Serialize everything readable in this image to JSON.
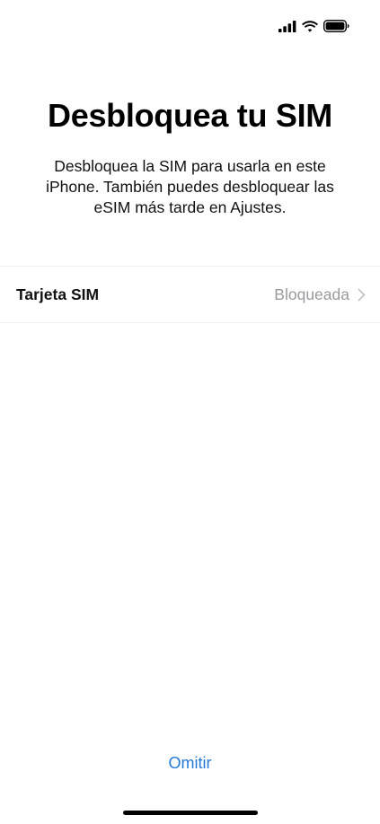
{
  "status_bar": {
    "icons": [
      "cellular-signal-icon",
      "wifi-icon",
      "battery-icon"
    ]
  },
  "header": {
    "title": "Desbloquea tu SIM",
    "subtitle": "Desbloquea la SIM para usarla en este iPhone. También puedes desbloquear las eSIM más tarde en Ajustes."
  },
  "sim_row": {
    "label": "Tarjeta SIM",
    "value": "Bloqueada",
    "icon": "chevron-right-icon"
  },
  "footer": {
    "skip_label": "Omitir"
  },
  "colors": {
    "accent": "#2478d8",
    "secondary_text": "#9a9a9f",
    "divider": "#eeeeef"
  }
}
